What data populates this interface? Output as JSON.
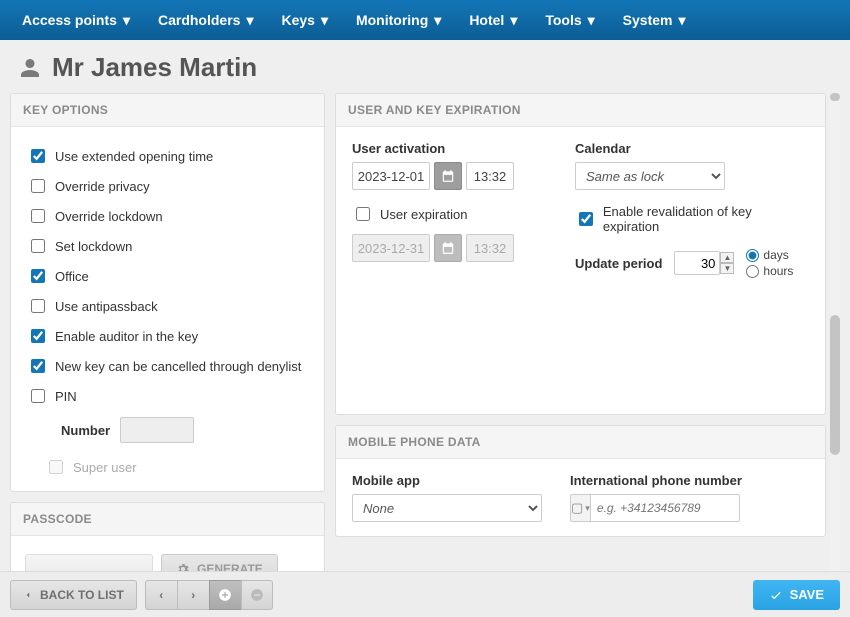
{
  "nav": {
    "items": [
      "Access points",
      "Cardholders",
      "Keys",
      "Monitoring",
      "Hotel",
      "Tools",
      "System"
    ]
  },
  "page_title": "Mr James Martin",
  "panels": {
    "key_options": {
      "header": "KEY OPTIONS",
      "options": [
        {
          "label": "Use extended opening time",
          "checked": true
        },
        {
          "label": "Override privacy",
          "checked": false
        },
        {
          "label": "Override lockdown",
          "checked": false
        },
        {
          "label": "Set lockdown",
          "checked": false
        },
        {
          "label": "Office",
          "checked": true
        },
        {
          "label": "Use antipassback",
          "checked": false
        },
        {
          "label": "Enable auditor in the key",
          "checked": true
        },
        {
          "label": "New key can be cancelled through denylist",
          "checked": true
        },
        {
          "label": "PIN",
          "checked": false
        }
      ],
      "number_label": "Number",
      "number_value": "",
      "super_user_label": "Super user",
      "super_user_checked": false
    },
    "user_key_exp": {
      "header": "USER AND KEY EXPIRATION",
      "user_activation_label": "User activation",
      "user_activation_date": "2023-12-01",
      "user_activation_time": "13:32",
      "calendar_label": "Calendar",
      "calendar_value": "Same as lock",
      "user_expiration_label": "User expiration",
      "user_expiration_date": "2023-12-31",
      "user_expiration_time": "13:32",
      "user_expiration_checked": false,
      "enable_revalidation_label": "Enable revalidation of key expiration",
      "enable_revalidation_checked": true,
      "update_period_label": "Update period",
      "update_period_value": "30",
      "unit_days": "days",
      "unit_hours": "hours",
      "unit_selected": "days"
    },
    "passcode": {
      "header": "PASSCODE",
      "generate_label": "GENERATE"
    },
    "mobile": {
      "header": "MOBILE PHONE DATA",
      "mobile_app_label": "Mobile app",
      "mobile_app_value": "None",
      "phone_label": "International phone number",
      "phone_placeholder": "e.g. +34123456789"
    }
  },
  "footer": {
    "back_label": "BACK TO LIST",
    "save_label": "SAVE"
  }
}
